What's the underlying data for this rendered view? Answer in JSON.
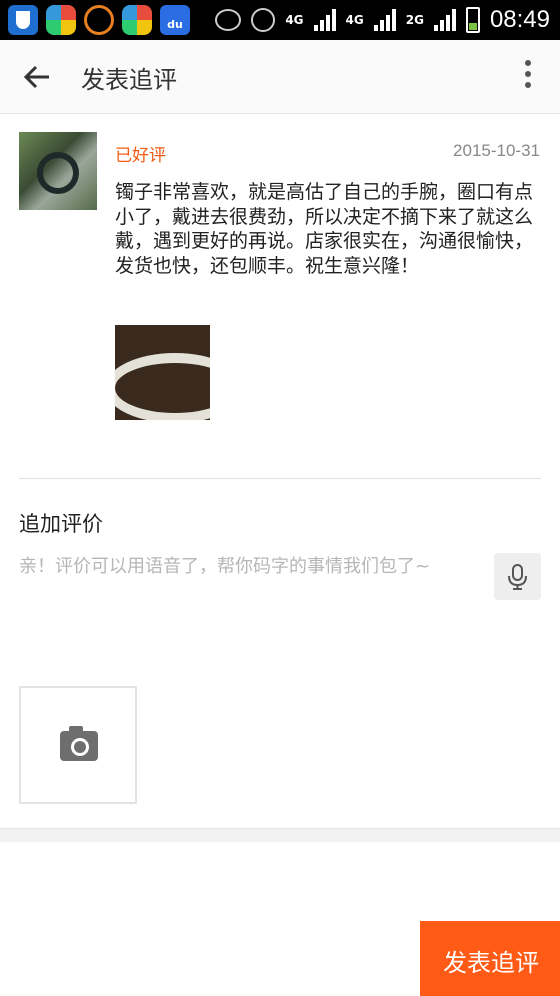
{
  "status_bar": {
    "network_1": "4G",
    "network_2": "4G",
    "network_3": "2G",
    "time": "08:49"
  },
  "appbar": {
    "title": "发表追评"
  },
  "review": {
    "rating_label": "已好评",
    "date": "2015-10-31",
    "text": "镯子非常喜欢，就是高估了自己的手腕，圈口有点小了，戴进去很费劲，所以决定不摘下来了就这么戴，遇到更好的再说。店家很实在，沟通很愉快，发货也快，还包顺丰。祝生意兴隆！"
  },
  "followup": {
    "label": "追加评价",
    "placeholder": "亲！评价可以用语音了，帮你码字的事情我们包了~"
  },
  "submit": {
    "label": "发表追评"
  },
  "colors": {
    "accent": "#f25a12",
    "button": "#ff5a16"
  }
}
